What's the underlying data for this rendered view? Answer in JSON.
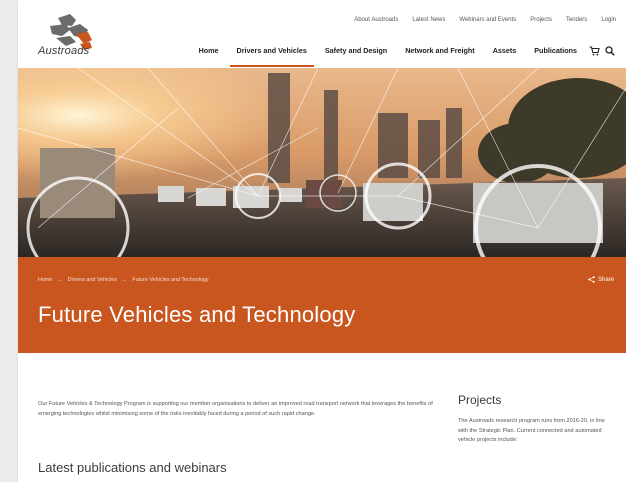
{
  "brand": {
    "name": "Austroads"
  },
  "util_nav": [
    "About Austroads",
    "Latest News",
    "Webinars and Events",
    "Projects",
    "Tenders",
    "Login"
  ],
  "main_nav": [
    {
      "label": "Home",
      "active": false
    },
    {
      "label": "Drivers and Vehicles",
      "active": true
    },
    {
      "label": "Safety and Design",
      "active": false
    },
    {
      "label": "Network and Freight",
      "active": false
    },
    {
      "label": "Assets",
      "active": false
    },
    {
      "label": "Publications",
      "active": false
    }
  ],
  "icons": {
    "cart": "cart-icon",
    "search": "search-icon"
  },
  "breadcrumb": [
    "Home",
    "Drivers and Vehicles",
    "Future Vehicles and Technology"
  ],
  "breadcrumb_sep": "→",
  "share_label": "Share",
  "page_title": "Future Vehicles and Technology",
  "intro_text": "Our Future Vehicles & Technology Program is supporting our member organisations to deliver an improved road transport network that leverages the benefits of emerging technologies whilst minimising some of the risks inevitably faced during a period of such rapid change.",
  "latest_heading": "Latest publications and webinars",
  "aside": {
    "heading": "Projects",
    "text": "The Austroads research program runs from 2016-20, in line with the Strategic Plan. Current connected and automated vehicle projects include:"
  },
  "colors": {
    "accent": "#c8561e",
    "page_bg": "#ececec"
  }
}
